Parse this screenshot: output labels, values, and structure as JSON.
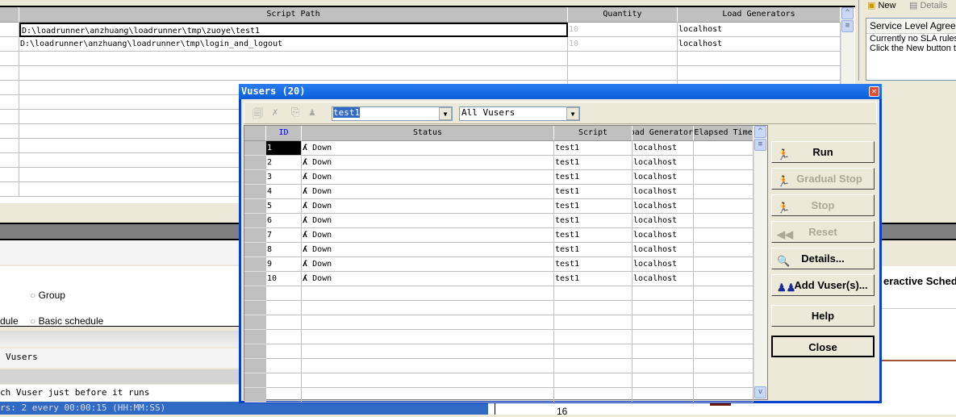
{
  "background": {
    "scripts_grid": {
      "columns": [
        "Script Path",
        "Quantity",
        "Load Generators"
      ],
      "rows": [
        {
          "path": "D:\\loadrunner\\anzhuang\\loadrunner\\tmp\\zuoye\\test1",
          "quantity": "10",
          "generator": "localhost"
        },
        {
          "path": "D:\\loadrunner\\anzhuang\\loadrunner\\tmp\\login_and_logout",
          "quantity": "10",
          "generator": "localhost"
        }
      ]
    },
    "sla": {
      "toolbar_new": "New",
      "toolbar_details": "Details",
      "title": "Service Level Agree",
      "line1": "Currently no SLA rules",
      "line2": "Click the New button t"
    },
    "schedule": {
      "radio_group": "Group",
      "radio_basic": "Basic schedule",
      "partial_left": "dule",
      "vusers_label": "Vusers",
      "init_text": "ch Vuser just before it runs",
      "status_text": "rs: 2 every 00:00:15 (HH:MM:SS)",
      "graph_title": "eractive Sched",
      "graph_tick": "16"
    }
  },
  "dialog": {
    "title": "Vusers (20)",
    "script_select": "test1",
    "filter_select": "All Vusers",
    "columns": [
      "ID",
      "Status",
      "Script",
      "Load Generator",
      "Elapsed Time"
    ],
    "rows": [
      {
        "id": "1",
        "status": "Down",
        "script": "test1",
        "generator": "localhost"
      },
      {
        "id": "2",
        "status": "Down",
        "script": "test1",
        "generator": "localhost"
      },
      {
        "id": "3",
        "status": "Down",
        "script": "test1",
        "generator": "localhost"
      },
      {
        "id": "4",
        "status": "Down",
        "script": "test1",
        "generator": "localhost"
      },
      {
        "id": "5",
        "status": "Down",
        "script": "test1",
        "generator": "localhost"
      },
      {
        "id": "6",
        "status": "Down",
        "script": "test1",
        "generator": "localhost"
      },
      {
        "id": "7",
        "status": "Down",
        "script": "test1",
        "generator": "localhost"
      },
      {
        "id": "8",
        "status": "Down",
        "script": "test1",
        "generator": "localhost"
      },
      {
        "id": "9",
        "status": "Down",
        "script": "test1",
        "generator": "localhost"
      },
      {
        "id": "10",
        "status": "Down",
        "script": "test1",
        "generator": "localhost"
      }
    ],
    "buttons": {
      "run": "Run",
      "gradual_stop": "Gradual Stop",
      "stop": "Stop",
      "reset": "Reset",
      "details": "Details...",
      "add_vusers": "Add Vuser(s)...",
      "help": "Help",
      "close": "Close"
    },
    "colors": {
      "title_bar": "#0a5fd8",
      "id_header": "#0000ff"
    }
  }
}
